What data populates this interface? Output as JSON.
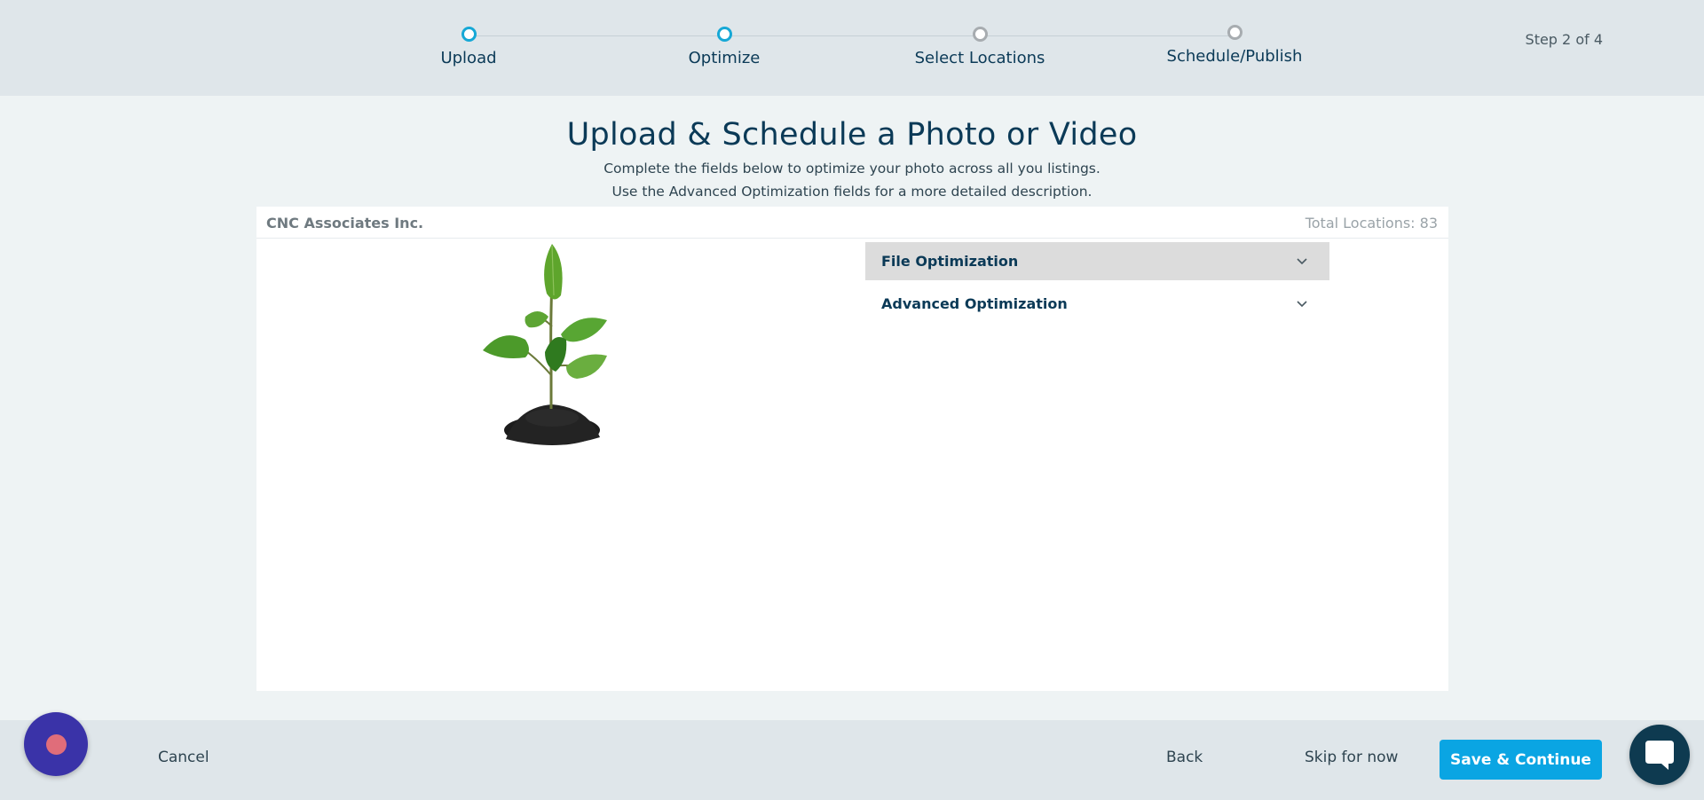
{
  "stepper": {
    "steps": [
      {
        "label": "Upload",
        "state": "complete"
      },
      {
        "label": "Optimize",
        "state": "current"
      },
      {
        "label": "Select Locations",
        "state": "pending"
      },
      {
        "label": "Schedule/Publish",
        "state": "pending"
      }
    ],
    "counter": "Step 2 of 4"
  },
  "header": {
    "title": "Upload & Schedule a Photo or Video",
    "subtitle_1": "Complete the fields below to optimize your photo across all you listings.",
    "subtitle_2": "Use the Advanced Optimization fields for a more detailed description."
  },
  "card": {
    "company": "CNC Associates Inc.",
    "total_locations": "Total Locations: 83",
    "image": "plant-seedling-photo",
    "accordions": [
      {
        "label": "File Optimization",
        "icon": "chevron-down-icon",
        "expanded": false
      },
      {
        "label": "Advanced Optimization",
        "icon": "chevron-down-icon",
        "expanded": false
      }
    ]
  },
  "footer": {
    "cancel": "Cancel",
    "back": "Back",
    "skip": "Skip for now",
    "save": "Save & Continue"
  },
  "widgets": {
    "assistant_icon": "assistant-icon",
    "chat_icon": "chat-bubble-icon"
  },
  "colors": {
    "accent": "#0aa5e3",
    "step_active": "#16a8d6",
    "step_inactive": "#a7acb0",
    "heading": "#0b3a57"
  }
}
